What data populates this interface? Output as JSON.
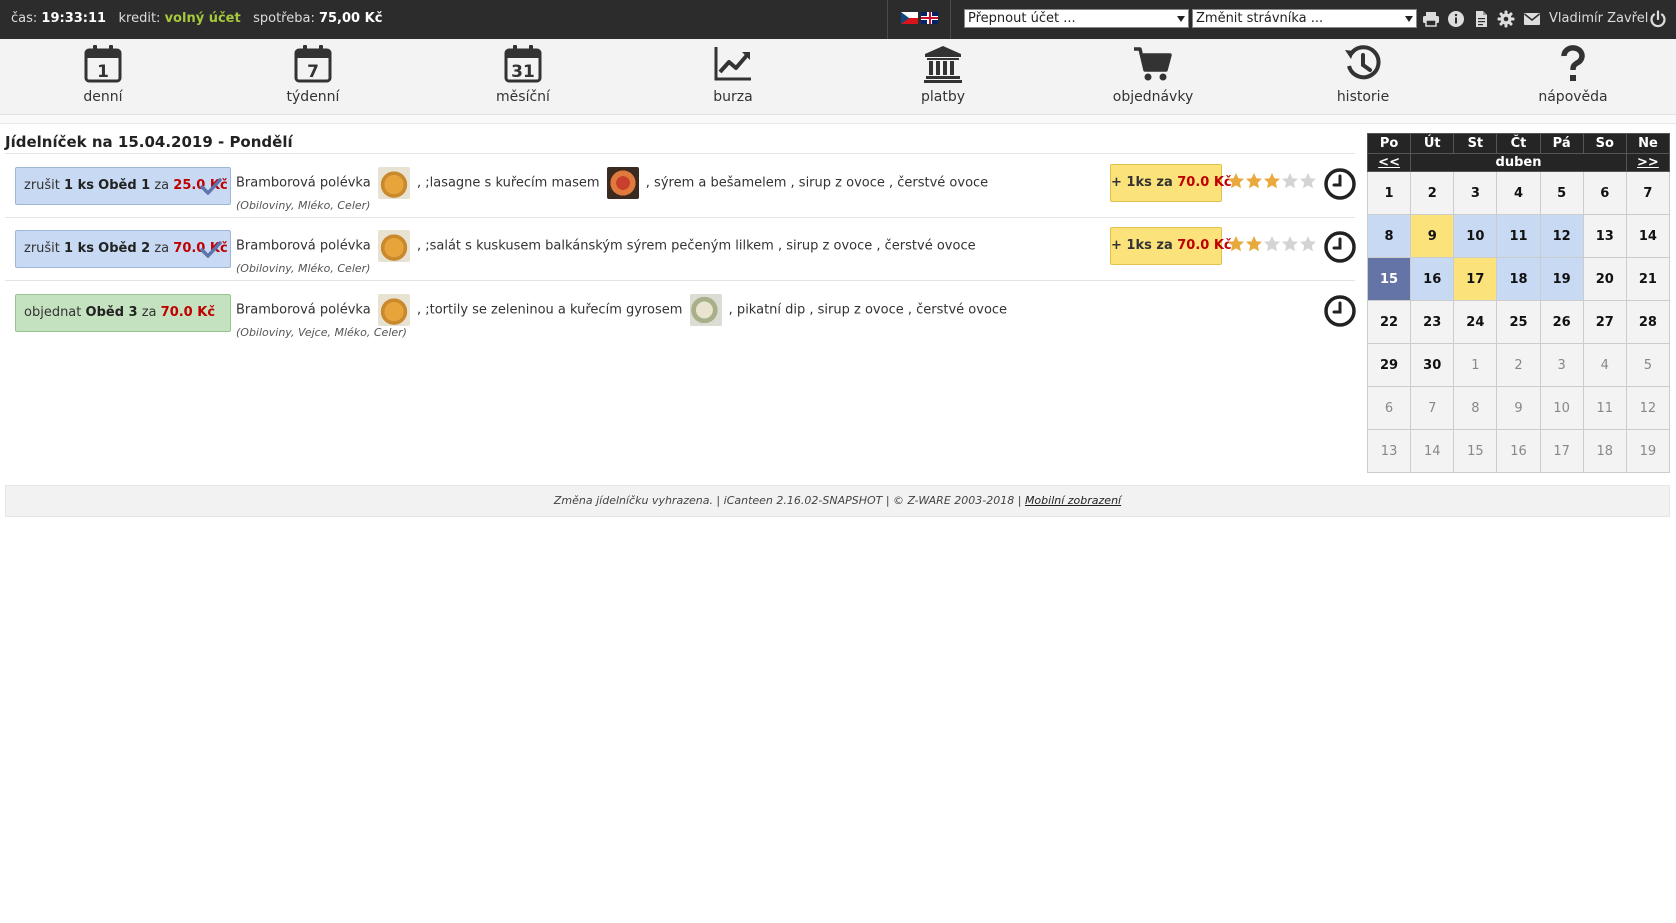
{
  "topbar": {
    "time_label": "čas:",
    "time_value": "19:33:11",
    "credit_label": "kredit:",
    "credit_value": "volný účet",
    "consumption_label": "spotřeba:",
    "consumption_value": "75,00 Kč",
    "switch_account": "Přepnout účet ...",
    "change_diner": "Změnit strávníka ...",
    "user_name": "Vladimír Zavřel",
    "colors": {
      "background": "#2c2c2c",
      "credit_accent": "#a5c83c"
    }
  },
  "nav": {
    "items": [
      {
        "label": "denní",
        "icon": "calendar-1-icon",
        "day": "1"
      },
      {
        "label": "týdenní",
        "icon": "calendar-7-icon",
        "day": "7"
      },
      {
        "label": "měsíční",
        "icon": "calendar-31-icon",
        "day": "31"
      },
      {
        "label": "burza",
        "icon": "chart-line-icon"
      },
      {
        "label": "platby",
        "icon": "bank-icon"
      },
      {
        "label": "objednávky",
        "icon": "cart-icon"
      },
      {
        "label": "historie",
        "icon": "history-icon"
      },
      {
        "label": "nápověda",
        "icon": "question-icon"
      }
    ]
  },
  "menu": {
    "title": "Jídelníček na 15.04.2019 - Pondělí",
    "meals": [
      {
        "action": "zrušit",
        "qty": "1 ks",
        "name": "Oběd 1",
        "za": "za",
        "price": "25.0 Kč",
        "soup": "Bramborová polévka",
        "main": ", ;lasagne s kuřecím masem",
        "rest": ", sýrem a bešamelem , sirup z ovoce , čerstvé ovoce",
        "allergens": "(Obiloviny, Mléko, Celer)",
        "extra": "+ 1ks za",
        "extra_price": "70.0 Kč",
        "rating": 3
      },
      {
        "action": "zrušit",
        "qty": "1 ks",
        "name": "Oběd 2",
        "za": "za",
        "price": "70.0 Kč",
        "soup": "Bramborová polévka",
        "main": ", ;salát s kuskusem balkánským sýrem pečeným lilkem , sirup z ovoce , čerstvé ovoce",
        "allergens": "(Obiloviny, Mléko, Celer)",
        "extra": "+ 1ks za",
        "extra_price": "70.0 Kč",
        "rating": 2
      },
      {
        "action": "objednat",
        "name": "Oběd 3",
        "za": "za",
        "price": "70.0 Kč",
        "soup": "Bramborová polévka",
        "main": ", ;tortily se zeleninou a kuřecím gyrosem",
        "rest": ", pikatní dip , sirup z ovoce , čerstvé ovoce",
        "allergens": "(Obiloviny, Vejce, Mléko, Celer)"
      }
    ]
  },
  "calendar": {
    "weekdays": [
      "Po",
      "Út",
      "St",
      "Čt",
      "Pá",
      "So",
      "Ne"
    ],
    "prev": "<<",
    "month": "duben",
    "next": ">>",
    "weeks": [
      [
        {
          "d": "1"
        },
        {
          "d": "2"
        },
        {
          "d": "3"
        },
        {
          "d": "4"
        },
        {
          "d": "5"
        },
        {
          "d": "6"
        },
        {
          "d": "7"
        }
      ],
      [
        {
          "d": "8",
          "s": "ordered"
        },
        {
          "d": "9",
          "s": "yellow"
        },
        {
          "d": "10",
          "s": "ordered"
        },
        {
          "d": "11",
          "s": "ordered"
        },
        {
          "d": "12",
          "s": "ordered"
        },
        {
          "d": "13"
        },
        {
          "d": "14"
        }
      ],
      [
        {
          "d": "15",
          "s": "selected"
        },
        {
          "d": "16",
          "s": "ordered"
        },
        {
          "d": "17",
          "s": "yellow"
        },
        {
          "d": "18",
          "s": "ordered"
        },
        {
          "d": "19",
          "s": "ordered"
        },
        {
          "d": "20"
        },
        {
          "d": "21"
        }
      ],
      [
        {
          "d": "22"
        },
        {
          "d": "23"
        },
        {
          "d": "24"
        },
        {
          "d": "25"
        },
        {
          "d": "26"
        },
        {
          "d": "27"
        },
        {
          "d": "28"
        }
      ],
      [
        {
          "d": "29"
        },
        {
          "d": "30"
        },
        {
          "d": "1",
          "s": "other"
        },
        {
          "d": "2",
          "s": "other"
        },
        {
          "d": "3",
          "s": "other"
        },
        {
          "d": "4",
          "s": "other"
        },
        {
          "d": "5",
          "s": "other"
        }
      ],
      [
        {
          "d": "6",
          "s": "other"
        },
        {
          "d": "7",
          "s": "other"
        },
        {
          "d": "8",
          "s": "other"
        },
        {
          "d": "9",
          "s": "other"
        },
        {
          "d": "10",
          "s": "other"
        },
        {
          "d": "11",
          "s": "other"
        },
        {
          "d": "12",
          "s": "other"
        }
      ],
      [
        {
          "d": "13",
          "s": "other"
        },
        {
          "d": "14",
          "s": "other"
        },
        {
          "d": "15",
          "s": "other"
        },
        {
          "d": "16",
          "s": "other"
        },
        {
          "d": "17",
          "s": "other"
        },
        {
          "d": "18",
          "s": "other"
        },
        {
          "d": "19",
          "s": "other"
        }
      ]
    ]
  },
  "footer": {
    "text": "Změna jídelníčku vyhrazena. | iCanteen 2.16.02-SNAPSHOT | © Z-WARE 2003-2018 |",
    "mobile_link": "Mobilní zobrazení"
  }
}
